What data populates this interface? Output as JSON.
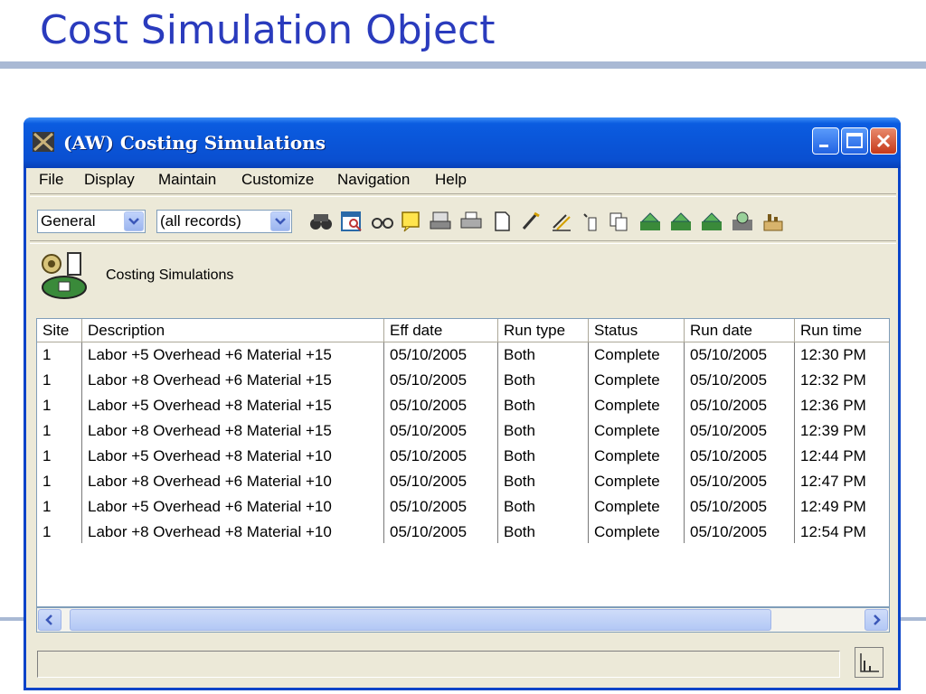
{
  "slide": {
    "title": "Cost Simulation Object"
  },
  "window": {
    "title": "(AW) Costing Simulations",
    "menu": [
      "File",
      "Display",
      "Maintain",
      "Customize",
      "Navigation",
      "Help"
    ],
    "combo_view": "General",
    "combo_filter": "(all records)",
    "section_label": "Costing Simulations"
  },
  "table": {
    "headers": [
      "Site",
      "Description",
      "Eff date",
      "Run type",
      "Status",
      "Run date",
      "Run time"
    ],
    "rows": [
      [
        "1",
        "Labor +5  Overhead +6  Material +15",
        "05/10/2005",
        "Both",
        "Complete",
        "05/10/2005",
        "12:30 PM"
      ],
      [
        "1",
        "Labor +8  Overhead +6  Material +15",
        "05/10/2005",
        "Both",
        "Complete",
        "05/10/2005",
        "12:32 PM"
      ],
      [
        "1",
        "Labor +5  Overhead +8  Material +15",
        "05/10/2005",
        "Both",
        "Complete",
        "05/10/2005",
        "12:36 PM"
      ],
      [
        "1",
        "Labor +8  Overhead +8  Material +15",
        "05/10/2005",
        "Both",
        "Complete",
        "05/10/2005",
        "12:39 PM"
      ],
      [
        "1",
        "Labor +5  Overhead +8  Material +10",
        "05/10/2005",
        "Both",
        "Complete",
        "05/10/2005",
        "12:44 PM"
      ],
      [
        "1",
        "Labor +8  Overhead +6  Material +10",
        "05/10/2005",
        "Both",
        "Complete",
        "05/10/2005",
        "12:47 PM"
      ],
      [
        "1",
        "Labor +5  Overhead +6  Material +10",
        "05/10/2005",
        "Both",
        "Complete",
        "05/10/2005",
        "12:49 PM"
      ],
      [
        "1",
        "Labor +8  Overhead +8  Material +10",
        "05/10/2005",
        "Both",
        "Complete",
        "05/10/2005",
        "12:54 PM"
      ]
    ]
  },
  "colors": {
    "accent": "#0a55d8",
    "title_text": "#2a3bbd",
    "window_bg": "#ece9d8"
  },
  "icons": {
    "toolbar": [
      "find-icon",
      "browse-icon",
      "view-icon",
      "note-icon",
      "print-preview-icon",
      "print-icon",
      "new-record-icon",
      "edit-icon",
      "edit-multiple-icon",
      "delete-icon",
      "copy-icon",
      "run-icon",
      "run-2-icon",
      "run-3-icon",
      "process-icon",
      "report-icon"
    ]
  }
}
